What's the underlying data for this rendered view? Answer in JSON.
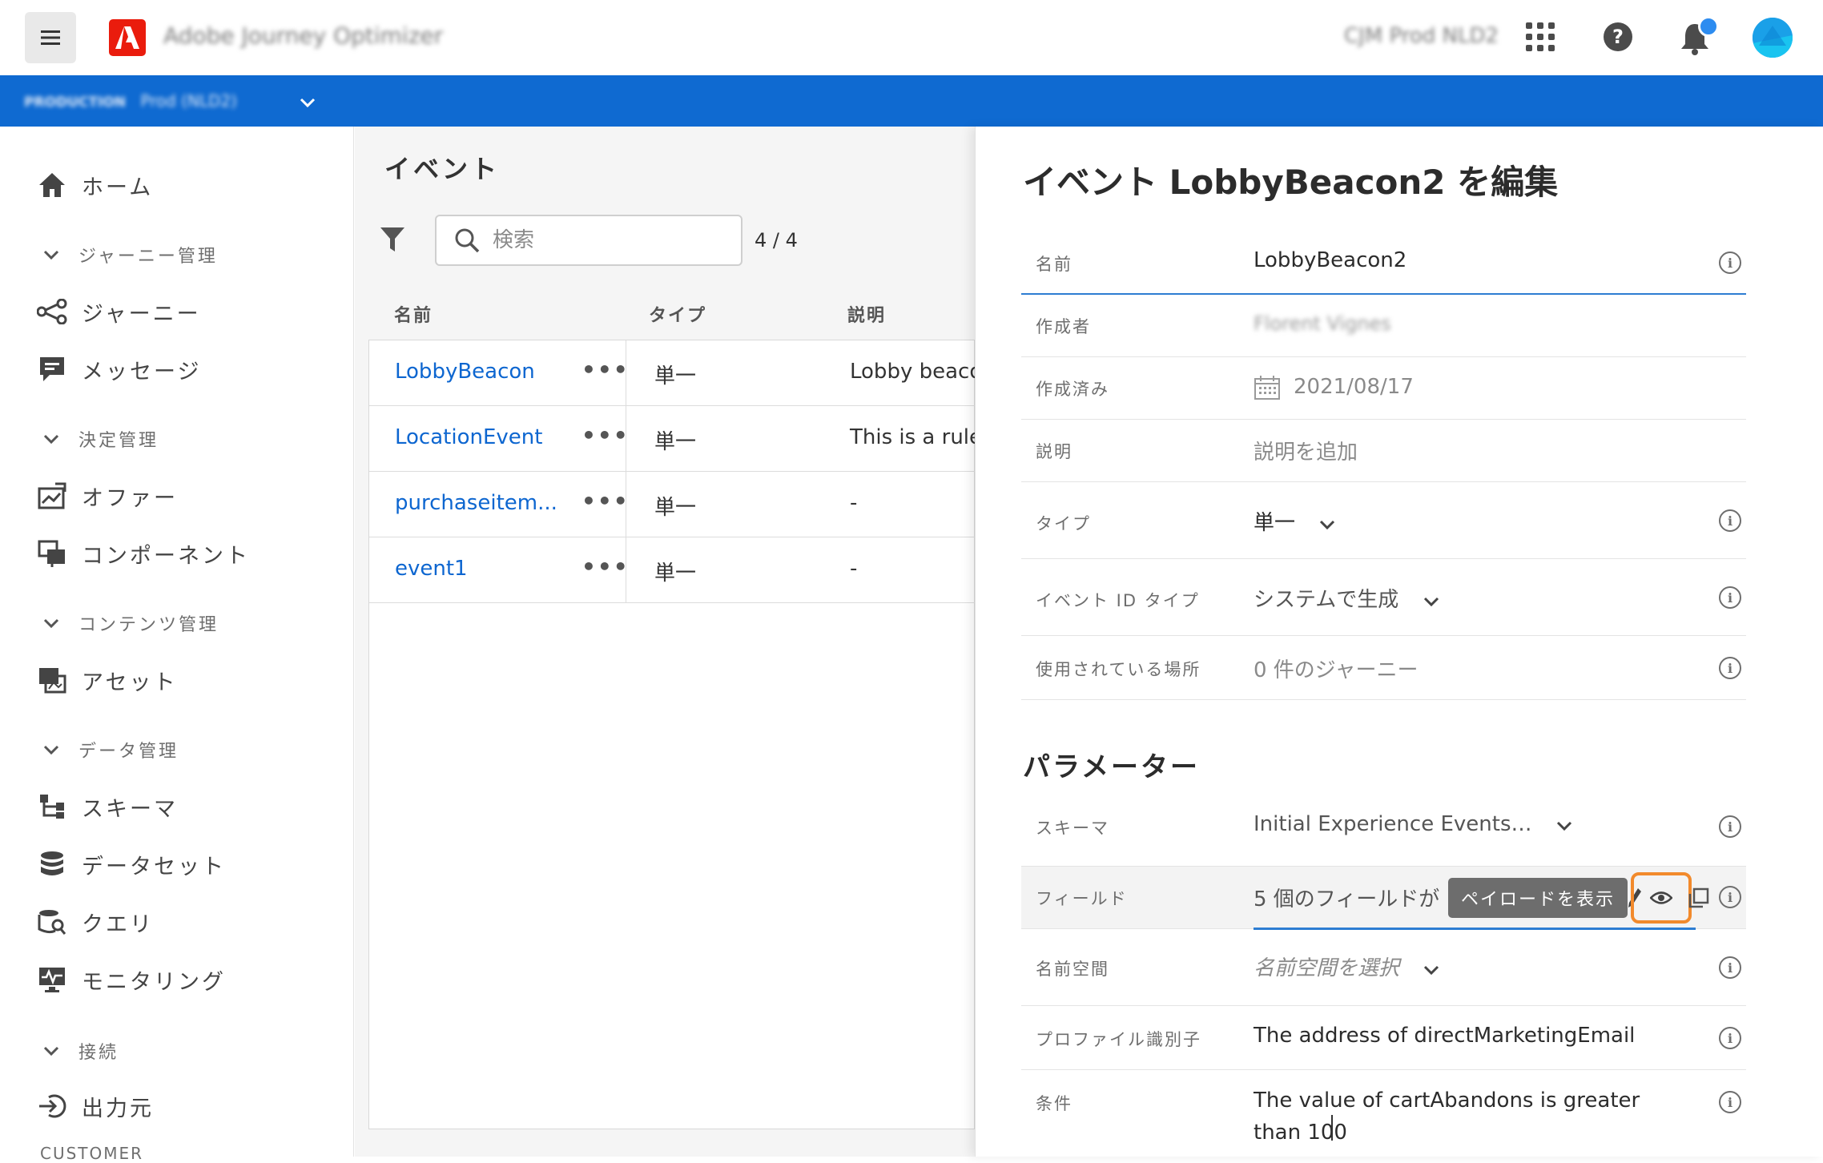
{
  "header": {
    "app_title": "Adobe Journey Optimizer",
    "org_name": "CJM Prod NLD2"
  },
  "sandbox": {
    "label": "PRODUCTION",
    "name": "Prod (NLD2)"
  },
  "sidebar": {
    "items": [
      {
        "type": "item",
        "icon": "home-icon",
        "label": "ホーム"
      },
      {
        "type": "section",
        "label": "ジャーニー管理"
      },
      {
        "type": "item",
        "icon": "journey-icon",
        "label": "ジャーニー"
      },
      {
        "type": "item",
        "icon": "message-icon",
        "label": "メッセージ"
      },
      {
        "type": "section",
        "label": "決定管理"
      },
      {
        "type": "item",
        "icon": "offer-icon",
        "label": "オファー"
      },
      {
        "type": "item",
        "icon": "component-icon",
        "label": "コンポーネント"
      },
      {
        "type": "section",
        "label": "コンテンツ管理"
      },
      {
        "type": "item",
        "icon": "asset-icon",
        "label": "アセット"
      },
      {
        "type": "section",
        "label": "データ管理"
      },
      {
        "type": "item",
        "icon": "schema-icon",
        "label": "スキーマ"
      },
      {
        "type": "item",
        "icon": "dataset-icon",
        "label": "データセット"
      },
      {
        "type": "item",
        "icon": "query-icon",
        "label": "クエリ"
      },
      {
        "type": "item",
        "icon": "monitoring-icon",
        "label": "モニタリング"
      },
      {
        "type": "section",
        "label": "接続"
      },
      {
        "type": "item",
        "icon": "source-icon",
        "label": "出力元"
      }
    ],
    "cut_section": "CUSTOMER"
  },
  "events_list": {
    "title": "イベント",
    "search_placeholder": "検索",
    "count": "4 / 4",
    "columns": {
      "name": "名前",
      "type": "タイプ",
      "description": "説明"
    },
    "rows": [
      {
        "name": "LobbyBeacon",
        "type": "単一",
        "description": "Lobby beacon"
      },
      {
        "name": "LocationEvent",
        "type": "単一",
        "description": "This is a rule-b"
      },
      {
        "name": "purchaseitem...",
        "type": "単一",
        "description": "-"
      },
      {
        "name": "event1",
        "type": "単一",
        "description": "-"
      }
    ]
  },
  "edit_panel": {
    "title": "イベント LobbyBeacon2 を編集",
    "fields": {
      "name": {
        "label": "名前",
        "value": "LobbyBeacon2"
      },
      "created_by": {
        "label": "作成者",
        "value": "Florent Vignes"
      },
      "created": {
        "label": "作成済み",
        "value": "2021/08/17"
      },
      "description": {
        "label": "説明",
        "placeholder": "説明を追加"
      },
      "type": {
        "label": "タイプ",
        "value": "単一"
      },
      "event_id_type": {
        "label": "イベント ID タイプ",
        "value": "システムで生成"
      },
      "used_in": {
        "label": "使用されている場所",
        "value": "0 件のジャーニー"
      }
    },
    "parameters_title": "パラメーター",
    "params": {
      "schema": {
        "label": "スキーマ",
        "value": "Initial Experience Events…"
      },
      "fields": {
        "label": "フィールド",
        "value": "5 個のフィールドが",
        "tooltip": "ペイロードを表示"
      },
      "namespace": {
        "label": "名前空間",
        "placeholder": "名前空間を選択"
      },
      "profile_id": {
        "label": "プロファイル識別子",
        "value": "The address of directMarketingEmail"
      },
      "condition": {
        "label": "条件",
        "value_line1": "The value of cartAbandons is greater",
        "value_line2": "than 100"
      }
    }
  },
  "colors": {
    "brand_red": "#ea1c0d",
    "blue_bar": "#0f6ad1",
    "link_blue": "#0d66d0",
    "highlight_orange": "#f28a2c"
  }
}
